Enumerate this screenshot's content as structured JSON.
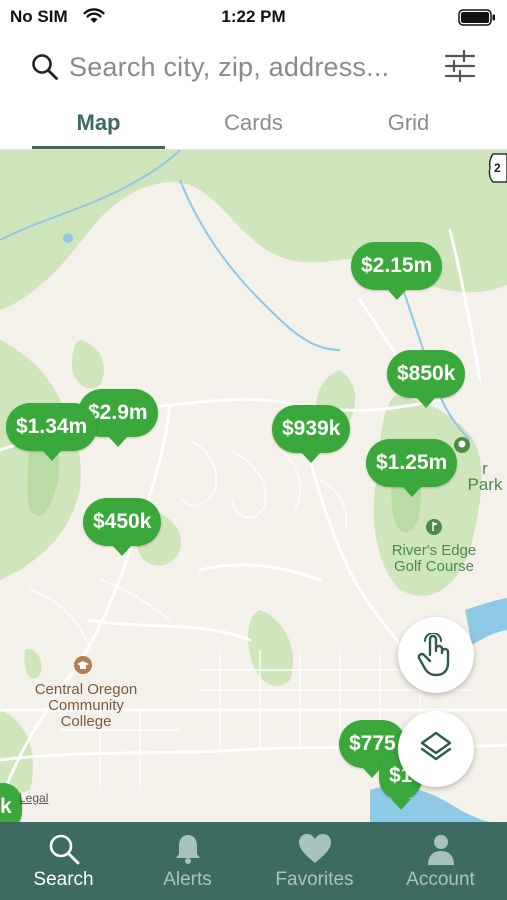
{
  "status_bar": {
    "carrier": "No SIM",
    "time": "1:22 PM"
  },
  "search": {
    "placeholder": "Search city, zip, address..."
  },
  "tabs": [
    {
      "label": "Map",
      "active": true
    },
    {
      "label": "Cards",
      "active": false
    },
    {
      "label": "Grid",
      "active": false
    }
  ],
  "map": {
    "labels": {
      "golf_course": "River's Edge Golf Course",
      "golf_line1": "River's Edge",
      "golf_line2": "Golf Course",
      "college_line1": "Central Oregon",
      "college_line2": "Community",
      "college_line3": "College",
      "park_partial": "r Park",
      "legal": "Legal",
      "highway_shield": "2"
    },
    "pins": [
      "$2.15m",
      "$850k",
      "$1.34m",
      "$2.9m",
      "$939k",
      "$1.25m",
      "$450k",
      "$775",
      "$1",
      "k"
    ]
  },
  "bottom_nav": [
    {
      "label": "Search",
      "icon": "search-icon",
      "active": true
    },
    {
      "label": "Alerts",
      "icon": "bell-icon",
      "active": false
    },
    {
      "label": "Favorites",
      "icon": "heart-icon",
      "active": false
    },
    {
      "label": "Account",
      "icon": "person-icon",
      "active": false
    }
  ],
  "colors": {
    "brand_green": "#3d6b62",
    "pin_green": "#3aa83a",
    "inactive_tab": "#8c8c8c",
    "map_background": "#f4f1ea",
    "map_park_green": "#c9e4b8",
    "water_blue": "#8ec9e6"
  }
}
